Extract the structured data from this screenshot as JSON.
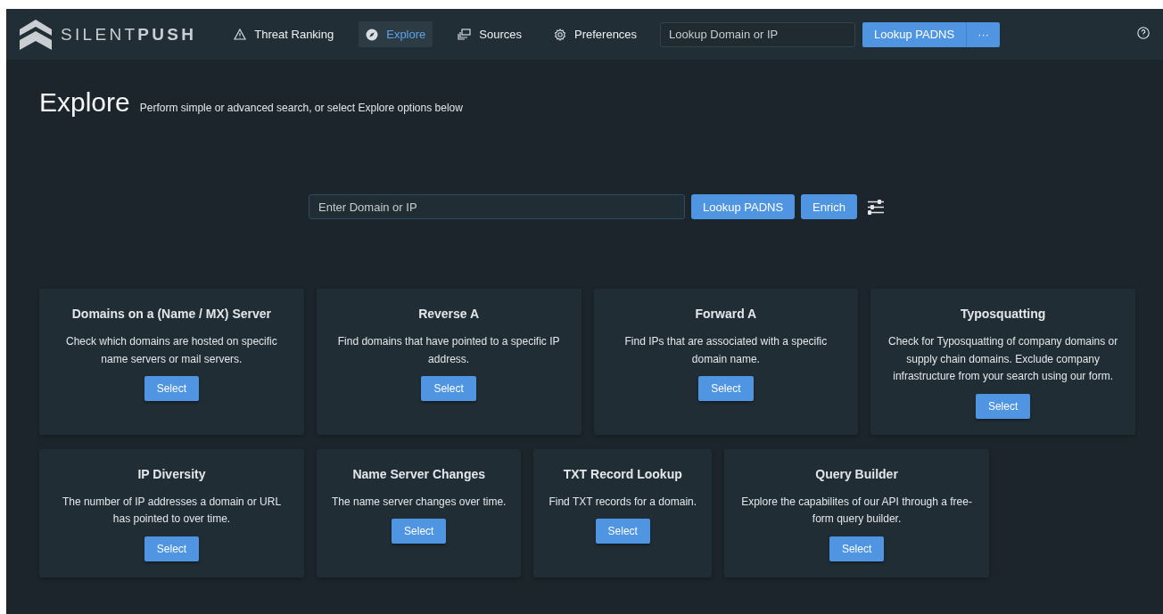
{
  "header": {
    "logo": {
      "light": "SILENT",
      "bold": "PUSH"
    },
    "nav": [
      {
        "label": "Threat Ranking",
        "selected": false
      },
      {
        "label": "Explore",
        "selected": true
      },
      {
        "label": "Sources",
        "selected": false
      },
      {
        "label": "Preferences",
        "selected": false
      }
    ],
    "search": {
      "placeholder": "Lookup Domain or IP"
    },
    "lookup_button": "Lookup PADNS",
    "more_button": "···"
  },
  "page": {
    "title": "Explore",
    "subtitle": "Perform simple or advanced search, or select Explore options below"
  },
  "search": {
    "placeholder": "Enter Domain or IP",
    "buttons": [
      "Lookup PADNS",
      "Enrich"
    ]
  },
  "card_rows": [
    [
      {
        "title": "Domains on a (Name / MX) Server",
        "description": "Check which domains are hosted on specific name servers or mail servers.",
        "button": "Select"
      },
      {
        "title": "Reverse A",
        "description": "Find domains that have pointed to a specific IP address.",
        "button": "Select"
      },
      {
        "title": "Forward A",
        "description": "Find IPs that are associated with a specific domain name.",
        "button": "Select"
      },
      {
        "title": "Typosquatting",
        "description": "Check for Typosquatting of company domains or supply chain domains. Exclude company infrastructure from your search using our form.",
        "button": "Select"
      }
    ],
    [
      {
        "title": "IP Diversity",
        "description": "The number of IP addresses a domain or URL has pointed to over time.",
        "button": "Select"
      },
      {
        "title": "Name Server Changes",
        "description": "The name server changes over time.",
        "button": "Select"
      },
      {
        "title": "TXT Record Lookup",
        "description": "Find TXT records for a domain.",
        "button": "Select"
      },
      {
        "title": "Query Builder",
        "description": "Explore the capabilites of our API through a free-form query builder.",
        "button": "Select"
      }
    ]
  ]
}
